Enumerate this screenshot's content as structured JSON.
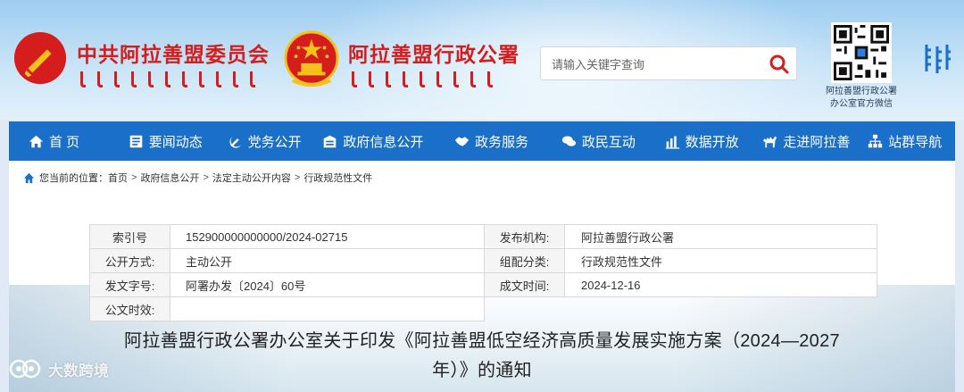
{
  "header": {
    "party_name": "中共阿拉善盟委员会",
    "gov_name": "阿拉善盟行政公署",
    "search": {
      "placeholder": "请输入关键字查询"
    },
    "qr_caption_line1": "阿拉善盟行政公署",
    "qr_caption_line2": "办公室官方微信"
  },
  "nav": {
    "items": [
      {
        "label": "首 页",
        "icon": "home-icon"
      },
      {
        "label": "要闻动态",
        "icon": "news-icon"
      },
      {
        "label": "党务公开",
        "icon": "party-icon"
      },
      {
        "label": "政府信息公开",
        "icon": "info-icon"
      },
      {
        "label": "政务服务",
        "icon": "handshake-icon"
      },
      {
        "label": "政民互动",
        "icon": "chat-icon"
      },
      {
        "label": "数据开放",
        "icon": "chart-icon"
      },
      {
        "label": "走进阿拉善",
        "icon": "camel-icon"
      },
      {
        "label": "站群导航",
        "icon": "sitemap-icon"
      }
    ]
  },
  "breadcrumb": {
    "prefix": "您当前的位置：",
    "items": [
      "首页",
      "政府信息公开",
      "法定主动公开内容",
      "行政规范性文件"
    ],
    "separator": ">"
  },
  "meta": {
    "rows": [
      {
        "label1": "索引号",
        "value1": "152900000000000/2024-02715",
        "label2": "发布机构:",
        "value2": "阿拉善盟行政公署"
      },
      {
        "label1": "公开方式:",
        "value1": "主动公开",
        "label2": "组配分类:",
        "value2": "行政规范性文件"
      },
      {
        "label1": "发文字号:",
        "value1": "阿署办发〔2024〕60号",
        "label2": "成文时间:",
        "value2": "2024-12-16"
      },
      {
        "label1": "公文时效:",
        "value1": ""
      }
    ]
  },
  "document": {
    "title_line1": "阿拉善盟行政公署办公室关于印发《阿拉善盟低空经济高质量发展实施方案（2024—2027",
    "title_line2": "年）》的通知"
  },
  "watermark": {
    "text": "大数跨境"
  },
  "colors": {
    "nav_bg": "#1a6fc8",
    "brand_red": "#d51d1d",
    "emblem_gold": "#f5c11b"
  }
}
